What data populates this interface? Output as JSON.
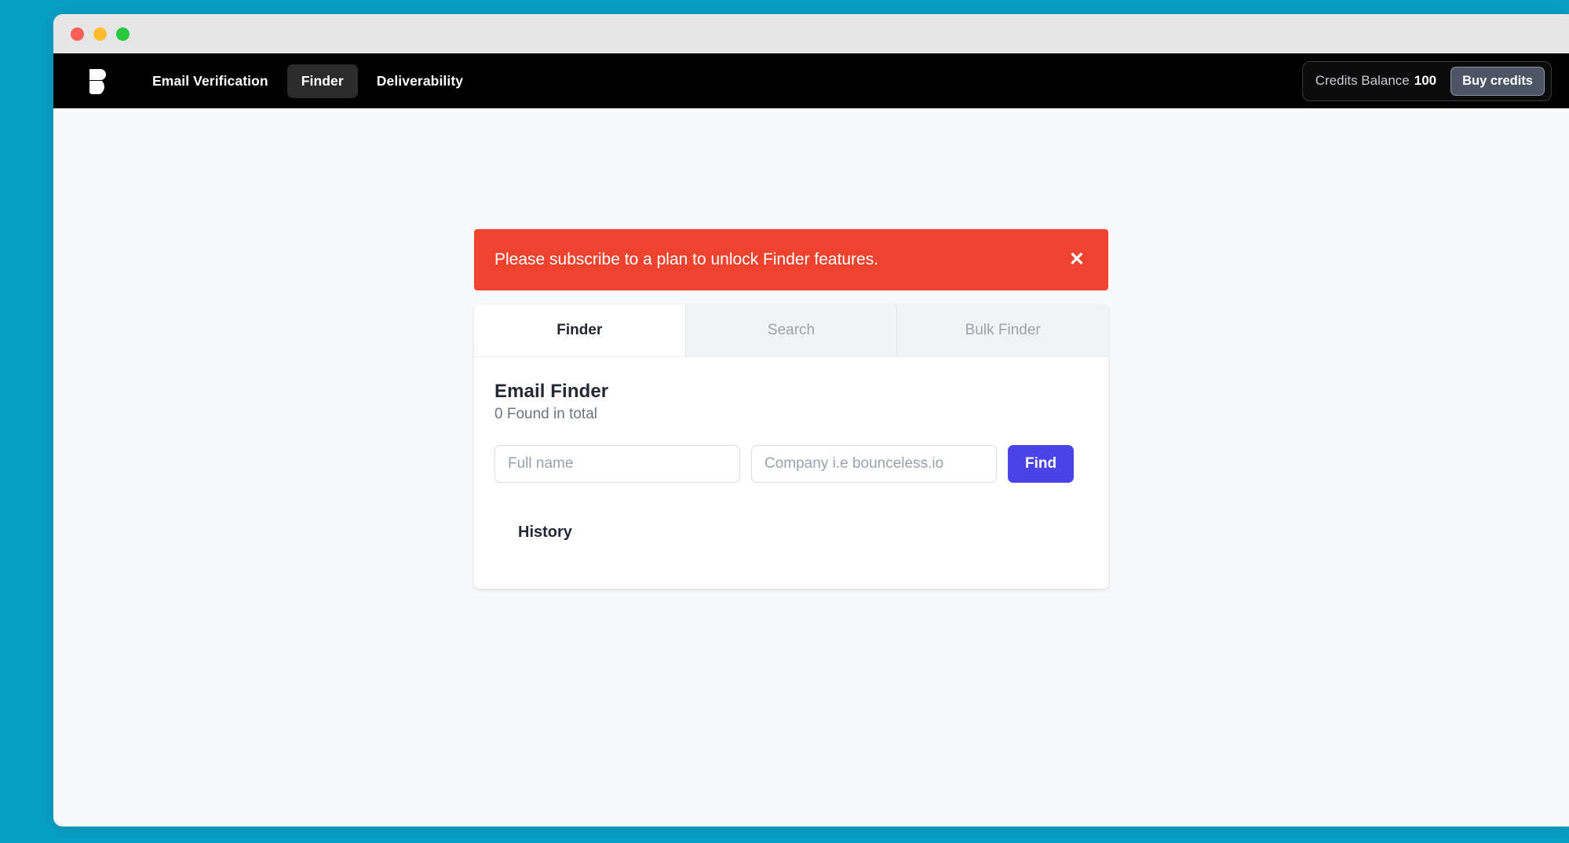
{
  "window": {
    "traffic_lights": [
      {
        "name": "close",
        "color": "#FF5F56"
      },
      {
        "name": "minimize",
        "color": "#FFBD2E"
      },
      {
        "name": "maximize",
        "color": "#27C93F"
      }
    ]
  },
  "navbar": {
    "logo_name": "bounceless-logo",
    "links": [
      {
        "label": "Email Verification",
        "active": false
      },
      {
        "label": "Finder",
        "active": true
      },
      {
        "label": "Deliverability",
        "active": false
      }
    ],
    "credits_label": "Credits Balance",
    "credits_value": "100",
    "buy_credits_label": "Buy credits"
  },
  "alert": {
    "message": "Please subscribe to a plan to unlock Finder features.",
    "close_icon": "close-icon",
    "close_glyph": "✕",
    "background": "#F0432F"
  },
  "card": {
    "tabs": [
      {
        "label": "Finder",
        "active": true
      },
      {
        "label": "Search",
        "active": false
      },
      {
        "label": "Bulk Finder",
        "active": false
      }
    ],
    "heading": "Email Finder",
    "subheading": "0 Found in total",
    "form": {
      "fullname_placeholder": "Full name",
      "fullname_value": "",
      "company_placeholder": "Company i.e bounceless.io",
      "company_value": "",
      "find_label": "Find",
      "find_color": "#4A43E8"
    },
    "history_title": "History"
  },
  "theme": {
    "desktop_background": "#089FC4",
    "page_background": "#F8F9FB",
    "navbar_background": "#000000"
  }
}
